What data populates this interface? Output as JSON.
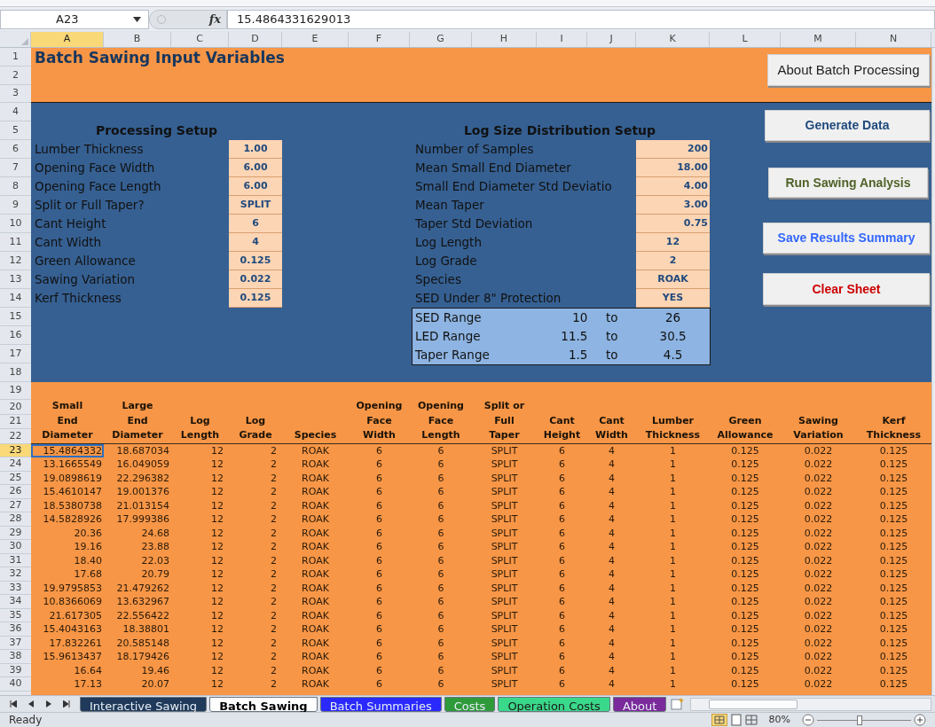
{
  "formula_bar": {
    "cell": "A23",
    "function_label": "fx",
    "formula": "15.4864331629013"
  },
  "columns": [
    {
      "label": "A",
      "selected": true
    },
    {
      "label": "B",
      "selected": false
    },
    {
      "label": "C",
      "selected": false
    },
    {
      "label": "D",
      "selected": false
    },
    {
      "label": "E",
      "selected": false
    },
    {
      "label": "F",
      "selected": false
    },
    {
      "label": "G",
      "selected": false
    },
    {
      "label": "H",
      "selected": false
    },
    {
      "label": "I",
      "selected": false
    },
    {
      "label": "J",
      "selected": false
    },
    {
      "label": "K",
      "selected": false
    },
    {
      "label": "L",
      "selected": false
    },
    {
      "label": "M",
      "selected": false
    },
    {
      "label": "N",
      "selected": false
    }
  ],
  "row_numbers": [
    {
      "label": "1",
      "selected": false
    },
    {
      "label": "2",
      "selected": false
    },
    {
      "label": "3",
      "selected": false
    },
    {
      "label": "4",
      "selected": false
    },
    {
      "label": "5",
      "selected": false
    },
    {
      "label": "6",
      "selected": false
    },
    {
      "label": "7",
      "selected": false
    },
    {
      "label": "8",
      "selected": false
    },
    {
      "label": "9",
      "selected": false
    },
    {
      "label": "10",
      "selected": false
    },
    {
      "label": "11",
      "selected": false
    },
    {
      "label": "12",
      "selected": false
    },
    {
      "label": "13",
      "selected": false
    },
    {
      "label": "14",
      "selected": false
    },
    {
      "label": "15",
      "selected": false
    },
    {
      "label": "16",
      "selected": false
    },
    {
      "label": "17",
      "selected": false
    },
    {
      "label": "18",
      "selected": false
    },
    {
      "label": "19",
      "selected": false
    },
    {
      "label": "20",
      "selected": false
    },
    {
      "label": "21",
      "selected": false
    },
    {
      "label": "22",
      "selected": false
    },
    {
      "label": "23",
      "selected": true
    },
    {
      "label": "24",
      "selected": false
    },
    {
      "label": "25",
      "selected": false
    },
    {
      "label": "26",
      "selected": false
    },
    {
      "label": "27",
      "selected": false
    },
    {
      "label": "28",
      "selected": false
    },
    {
      "label": "29",
      "selected": false
    },
    {
      "label": "30",
      "selected": false
    },
    {
      "label": "31",
      "selected": false
    },
    {
      "label": "32",
      "selected": false
    },
    {
      "label": "33",
      "selected": false
    },
    {
      "label": "34",
      "selected": false
    },
    {
      "label": "35",
      "selected": false
    },
    {
      "label": "36",
      "selected": false
    },
    {
      "label": "37",
      "selected": false
    },
    {
      "label": "38",
      "selected": false
    },
    {
      "label": "39",
      "selected": false
    },
    {
      "label": "40",
      "selected": false
    }
  ],
  "title": "Batch Sawing Input Variables",
  "about_button": {
    "label": "About Batch Processing",
    "color": "#222222"
  },
  "action_buttons": [
    {
      "label": "Generate Data",
      "color": "#1f497d"
    },
    {
      "label": "Run Sawing Analysis",
      "color": "#4f6228"
    },
    {
      "label": "Save Results Summary",
      "color": "#3366ff"
    },
    {
      "label": "Clear Sheet",
      "color": "#cc0000"
    }
  ],
  "processing_setup": {
    "heading": "Processing Setup",
    "fields": [
      {
        "label": "Lumber Thickness",
        "value": "1.00"
      },
      {
        "label": "Opening Face Width",
        "value": "6.00"
      },
      {
        "label": "Opening Face Length",
        "value": "6.00"
      },
      {
        "label": "Split or Full Taper?",
        "value": "SPLIT"
      },
      {
        "label": "Cant Height",
        "value": "6"
      },
      {
        "label": "Cant Width",
        "value": "4"
      },
      {
        "label": "Green Allowance",
        "value": "0.125"
      },
      {
        "label": "Sawing Variation",
        "value": "0.022"
      },
      {
        "label": "Kerf Thickness",
        "value": "0.125"
      }
    ]
  },
  "log_setup": {
    "heading": "Log Size Distribution Setup",
    "fields": [
      {
        "label": "Number of Samples",
        "value": "200",
        "kind": "number"
      },
      {
        "label": "Mean Small End Diameter",
        "value": "18.00",
        "kind": "number"
      },
      {
        "label": "Small End Diameter Std Deviatio",
        "value": "4.00",
        "kind": "number"
      },
      {
        "label": "Mean Taper",
        "value": "3.00",
        "kind": "number"
      },
      {
        "label": "Taper Std Deviation",
        "value": "0.75",
        "kind": "number"
      },
      {
        "label": "Log Length",
        "value": "12",
        "kind": "choice"
      },
      {
        "label": "Log Grade",
        "value": "2",
        "kind": "choice"
      },
      {
        "label": "Species",
        "value": "ROAK",
        "kind": "choice"
      },
      {
        "label": "SED Under 8\" Protection",
        "value": "YES",
        "kind": "choice"
      }
    ],
    "ranges": [
      {
        "label": "SED Range",
        "low": "10",
        "to": "to",
        "high": "26"
      },
      {
        "label": "LED Range",
        "low": "11.5",
        "to": "to",
        "high": "30.5"
      },
      {
        "label": "Taper Range",
        "low": "1.5",
        "to": "to",
        "high": "4.5"
      }
    ]
  },
  "table": {
    "columns": [
      {
        "lines": [
          "Small",
          "End",
          "Diameter"
        ]
      },
      {
        "lines": [
          "Large",
          "End",
          "Diameter"
        ]
      },
      {
        "lines": [
          "Log",
          "Length"
        ]
      },
      {
        "lines": [
          "Log",
          "Grade"
        ]
      },
      {
        "lines": [
          "Species"
        ]
      },
      {
        "lines": [
          "Opening",
          "Face",
          "Width"
        ]
      },
      {
        "lines": [
          "Opening",
          "Face",
          "Length"
        ]
      },
      {
        "lines": [
          "Split or",
          "Full",
          "Taper"
        ]
      },
      {
        "lines": [
          "Cant",
          "Height"
        ]
      },
      {
        "lines": [
          "Cant",
          "Width"
        ]
      },
      {
        "lines": [
          "Lumber",
          "Thickness"
        ]
      },
      {
        "lines": [
          "Green",
          "Allowance"
        ]
      },
      {
        "lines": [
          "Sawing",
          "Variation"
        ]
      },
      {
        "lines": [
          "Kerf",
          "Thickness"
        ]
      }
    ],
    "rows": [
      {
        "selected": true,
        "cells": [
          "15.4864332",
          "18.687034",
          "12",
          "2",
          "ROAK",
          "6",
          "6",
          "SPLIT",
          "6",
          "4",
          "1",
          "0.125",
          "0.022",
          "0.125"
        ]
      },
      {
        "selected": false,
        "cells": [
          "13.1665549",
          "16.049059",
          "12",
          "2",
          "ROAK",
          "6",
          "6",
          "SPLIT",
          "6",
          "4",
          "1",
          "0.125",
          "0.022",
          "0.125"
        ]
      },
      {
        "selected": false,
        "cells": [
          "19.0898619",
          "22.296382",
          "12",
          "2",
          "ROAK",
          "6",
          "6",
          "SPLIT",
          "6",
          "4",
          "1",
          "0.125",
          "0.022",
          "0.125"
        ]
      },
      {
        "selected": false,
        "cells": [
          "15.4610147",
          "19.001376",
          "12",
          "2",
          "ROAK",
          "6",
          "6",
          "SPLIT",
          "6",
          "4",
          "1",
          "0.125",
          "0.022",
          "0.125"
        ]
      },
      {
        "selected": false,
        "cells": [
          "18.5380738",
          "21.013154",
          "12",
          "2",
          "ROAK",
          "6",
          "6",
          "SPLIT",
          "6",
          "4",
          "1",
          "0.125",
          "0.022",
          "0.125"
        ]
      },
      {
        "selected": false,
        "cells": [
          "14.5828926",
          "17.999386",
          "12",
          "2",
          "ROAK",
          "6",
          "6",
          "SPLIT",
          "6",
          "4",
          "1",
          "0.125",
          "0.022",
          "0.125"
        ]
      },
      {
        "selected": false,
        "cells": [
          "20.36",
          "24.68",
          "12",
          "2",
          "ROAK",
          "6",
          "6",
          "SPLIT",
          "6",
          "4",
          "1",
          "0.125",
          "0.022",
          "0.125"
        ]
      },
      {
        "selected": false,
        "cells": [
          "19.16",
          "23.88",
          "12",
          "2",
          "ROAK",
          "6",
          "6",
          "SPLIT",
          "6",
          "4",
          "1",
          "0.125",
          "0.022",
          "0.125"
        ]
      },
      {
        "selected": false,
        "cells": [
          "18.40",
          "22.03",
          "12",
          "2",
          "ROAK",
          "6",
          "6",
          "SPLIT",
          "6",
          "4",
          "1",
          "0.125",
          "0.022",
          "0.125"
        ]
      },
      {
        "selected": false,
        "cells": [
          "17.68",
          "20.79",
          "12",
          "2",
          "ROAK",
          "6",
          "6",
          "SPLIT",
          "6",
          "4",
          "1",
          "0.125",
          "0.022",
          "0.125"
        ]
      },
      {
        "selected": false,
        "cells": [
          "19.9795853",
          "21.479262",
          "12",
          "2",
          "ROAK",
          "6",
          "6",
          "SPLIT",
          "6",
          "4",
          "1",
          "0.125",
          "0.022",
          "0.125"
        ]
      },
      {
        "selected": false,
        "cells": [
          "10.8366069",
          "13.632967",
          "12",
          "2",
          "ROAK",
          "6",
          "6",
          "SPLIT",
          "6",
          "4",
          "1",
          "0.125",
          "0.022",
          "0.125"
        ]
      },
      {
        "selected": false,
        "cells": [
          "21.617305",
          "22.556422",
          "12",
          "2",
          "ROAK",
          "6",
          "6",
          "SPLIT",
          "6",
          "4",
          "1",
          "0.125",
          "0.022",
          "0.125"
        ]
      },
      {
        "selected": false,
        "cells": [
          "15.4043163",
          "18.38801",
          "12",
          "2",
          "ROAK",
          "6",
          "6",
          "SPLIT",
          "6",
          "4",
          "1",
          "0.125",
          "0.022",
          "0.125"
        ]
      },
      {
        "selected": false,
        "cells": [
          "17.832261",
          "20.585148",
          "12",
          "2",
          "ROAK",
          "6",
          "6",
          "SPLIT",
          "6",
          "4",
          "1",
          "0.125",
          "0.022",
          "0.125"
        ]
      },
      {
        "selected": false,
        "cells": [
          "15.9613437",
          "18.179426",
          "12",
          "2",
          "ROAK",
          "6",
          "6",
          "SPLIT",
          "6",
          "4",
          "1",
          "0.125",
          "0.022",
          "0.125"
        ]
      },
      {
        "selected": false,
        "cells": [
          "16.64",
          "19.46",
          "12",
          "2",
          "ROAK",
          "6",
          "6",
          "SPLIT",
          "6",
          "4",
          "1",
          "0.125",
          "0.022",
          "0.125"
        ]
      },
      {
        "selected": false,
        "cells": [
          "17.13",
          "20.07",
          "12",
          "2",
          "ROAK",
          "6",
          "6",
          "SPLIT",
          "6",
          "4",
          "1",
          "0.125",
          "0.022",
          "0.125"
        ]
      }
    ]
  },
  "sheet_tabs": [
    {
      "label": "Interactive Sawing",
      "color": "#1f3a5a",
      "selected": false
    },
    {
      "label": "Batch Sawing",
      "color": "#ffffff",
      "selected": true
    },
    {
      "label": "Batch Summaries",
      "color": "#2a2aff",
      "selected": false
    },
    {
      "label": "Costs",
      "color": "#2f9a3a",
      "selected": false
    },
    {
      "label": "Operation Costs",
      "color": "#3ad88a",
      "selected": false
    },
    {
      "label": "About",
      "color": "#7a2a9a",
      "selected": false
    }
  ],
  "status_bar": {
    "status": "Ready",
    "zoom": "80%",
    "zoom_slider": {
      "level": 0.45
    }
  }
}
